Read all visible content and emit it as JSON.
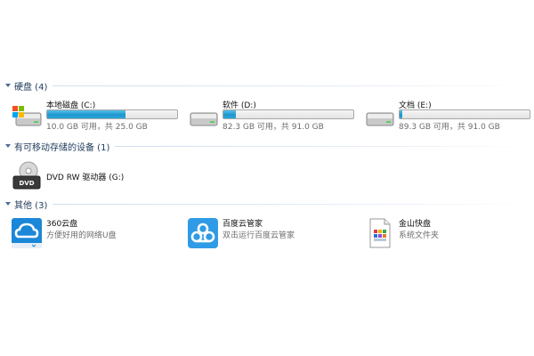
{
  "groups": {
    "drives": {
      "title": "硬盘 (4)"
    },
    "removable": {
      "title": "有可移动存储的设备 (1)"
    },
    "other": {
      "title": "其他 (3)"
    }
  },
  "drives": [
    {
      "name": "本地磁盘 (C:)",
      "free_text": "10.0 GB 可用，共 25.0 GB",
      "used_fraction": 0.6,
      "icon": "windows-drive-icon"
    },
    {
      "name": "软件 (D:)",
      "free_text": "82.3 GB 可用，共 91.0 GB",
      "used_fraction": 0.096,
      "icon": "hard-drive-icon"
    },
    {
      "name": "文档 (E:)",
      "free_text": "89.3 GB 可用，共 91.0 GB",
      "used_fraction": 0.019,
      "icon": "hard-drive-icon"
    }
  ],
  "removable": [
    {
      "name": "DVD RW 驱动器 (G:)",
      "icon": "dvd-drive-icon",
      "icon_label": "DVD"
    }
  ],
  "other": [
    {
      "name": "360云盘",
      "desc": "方便好用的网络U盘",
      "icon": "cloud-drive-icon"
    },
    {
      "name": "百度云管家",
      "desc": "双击运行百度云管家",
      "icon": "baidu-cloud-icon"
    },
    {
      "name": "金山快盘",
      "desc": "系统文件夹",
      "icon": "kuaipan-file-icon"
    }
  ],
  "colors": {
    "group_title": "#1e395b",
    "bar_fill": "#1e96cc",
    "cloud360_blue": "#1a87d8",
    "baidu_blue": "#2f9be6"
  }
}
